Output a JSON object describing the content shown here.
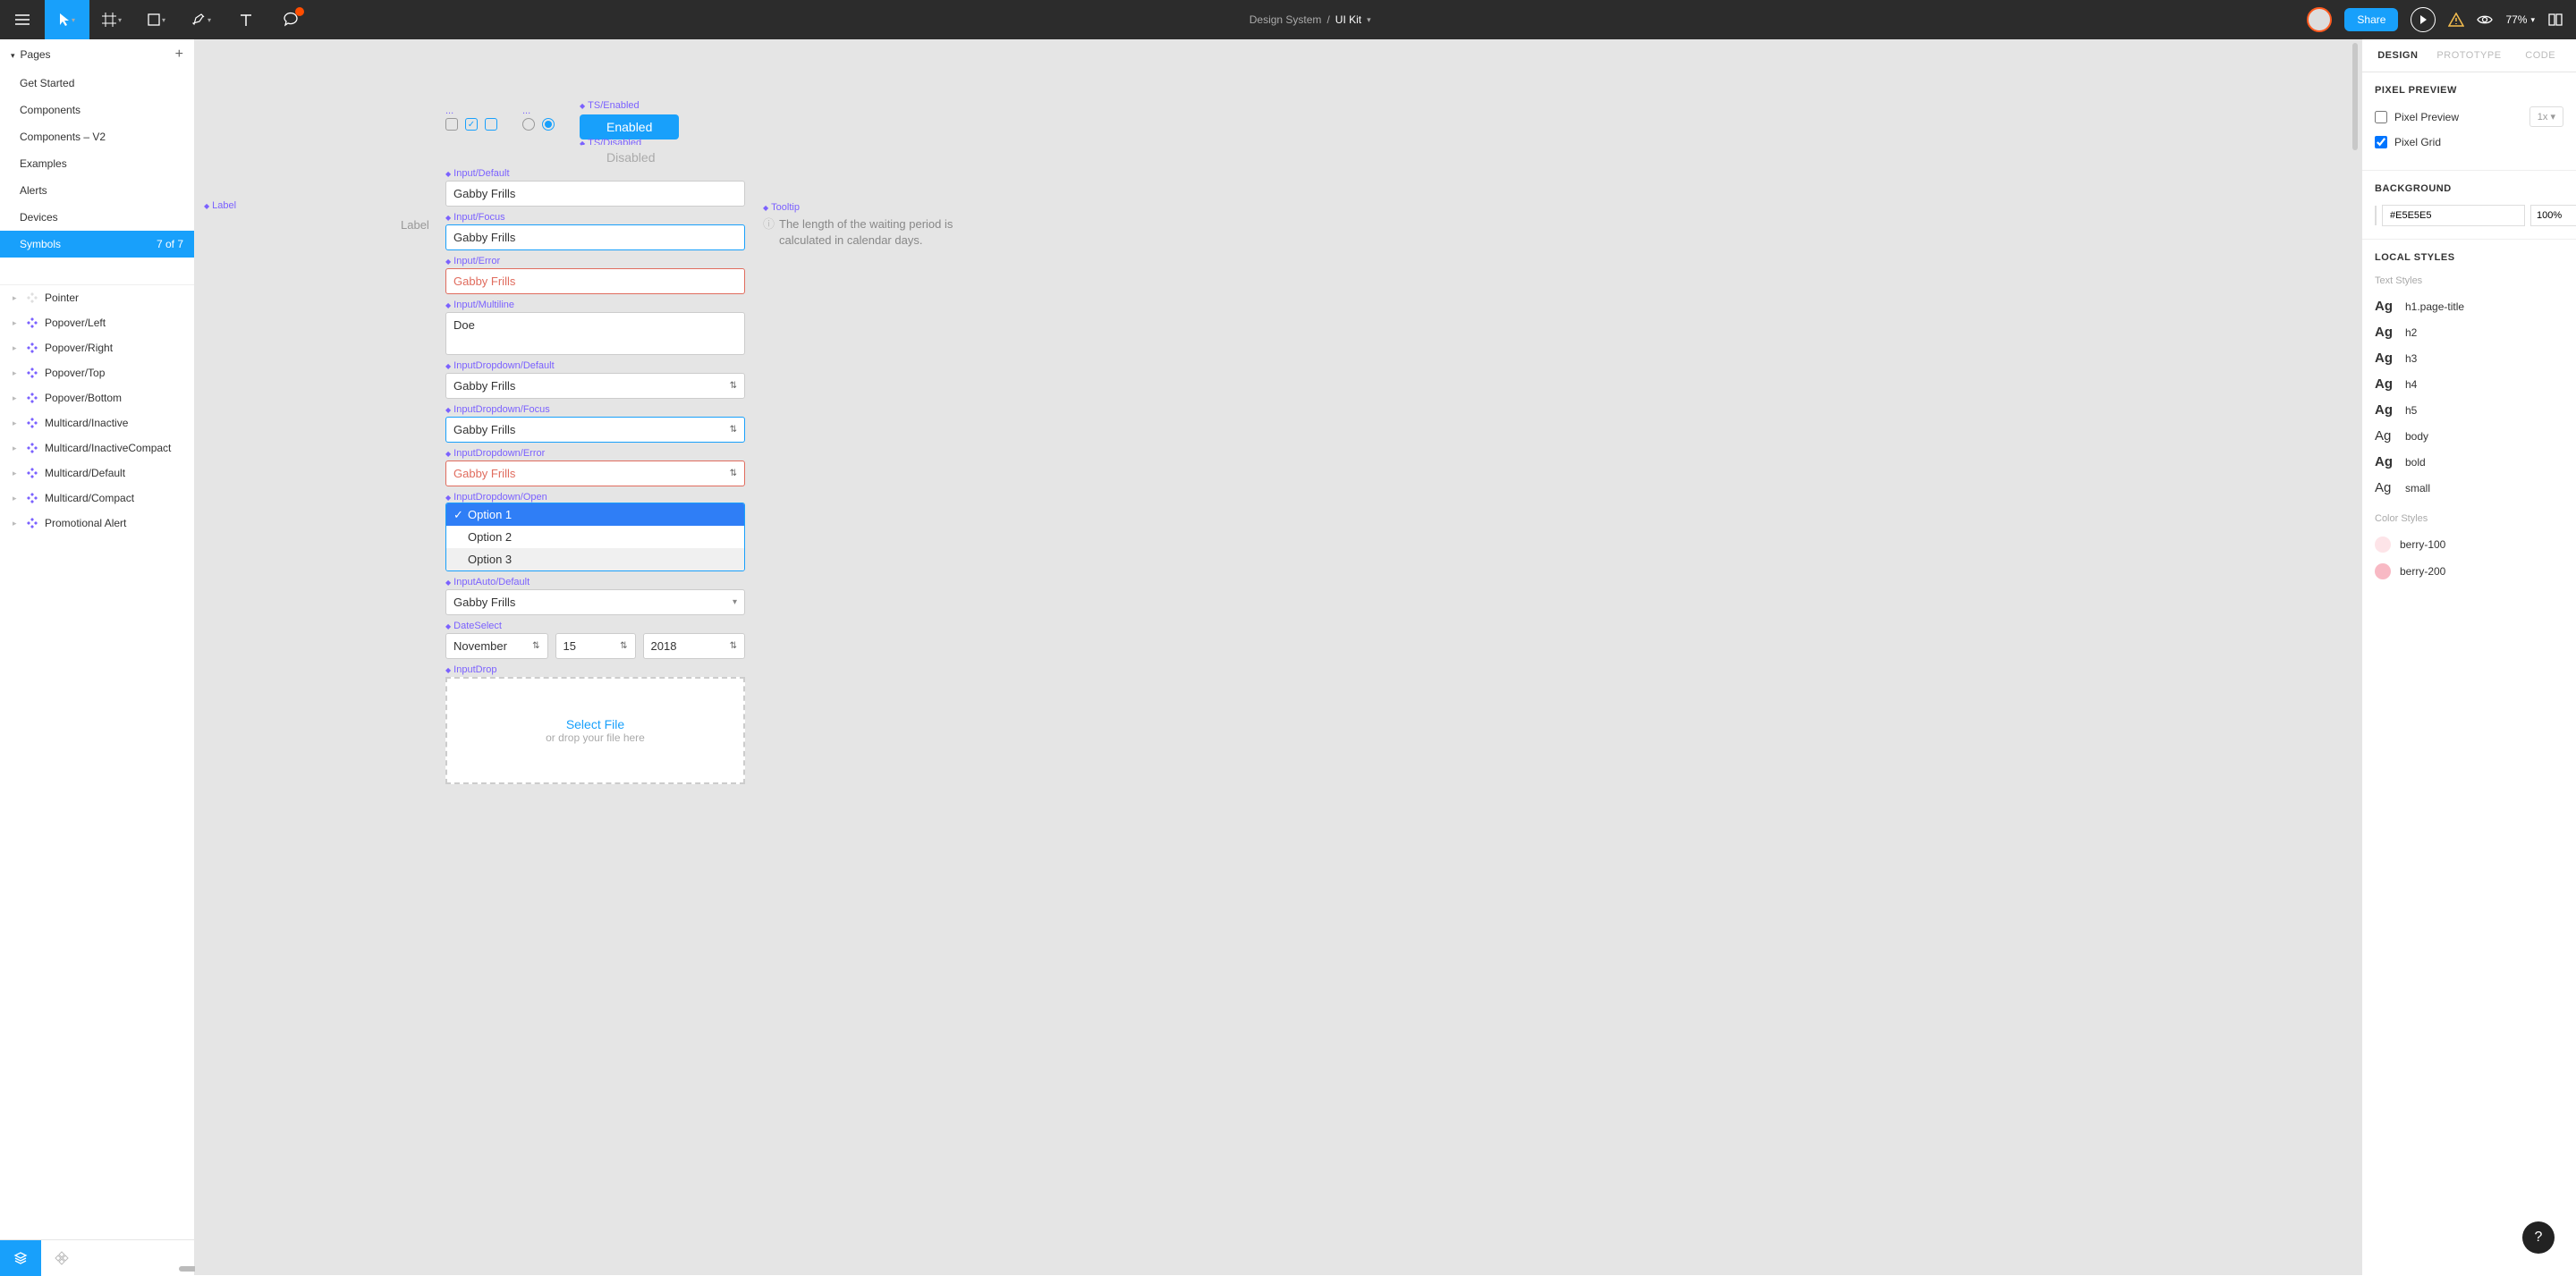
{
  "toolbar": {
    "breadcrumb_parent": "Design System",
    "breadcrumb_current": "UI Kit",
    "share_label": "Share",
    "zoom": "77%"
  },
  "left": {
    "pages_title": "Pages",
    "pages": [
      {
        "label": "Get Started"
      },
      {
        "label": "Components"
      },
      {
        "label": "Components – V2"
      },
      {
        "label": "Examples"
      },
      {
        "label": "Alerts"
      },
      {
        "label": "Devices"
      },
      {
        "label": "Symbols",
        "selected": true,
        "count": "7 of 7"
      }
    ],
    "layers": [
      {
        "label": "Pointer",
        "dim": true
      },
      {
        "label": "Popover/Left"
      },
      {
        "label": "Popover/Right"
      },
      {
        "label": "Popover/Top"
      },
      {
        "label": "Popover/Bottom"
      },
      {
        "label": "Multicard/Inactive"
      },
      {
        "label": "Multicard/InactiveCompact"
      },
      {
        "label": "Multicard/Default"
      },
      {
        "label": "Multicard/Compact"
      },
      {
        "label": "Promotional Alert"
      }
    ]
  },
  "canvas": {
    "label_frame": "Label",
    "label_text": "Label",
    "ts_enabled": "TS/Enabled",
    "ts_disabled": "TS/Disabled",
    "btn_enabled": "Enabled",
    "btn_disabled": "Disabled",
    "input_default": "Input/Default",
    "input_focus": "Input/Focus",
    "input_error": "Input/Error",
    "input_multiline": "Input/Multiline",
    "dd_default": "InputDropdown/Default",
    "dd_focus": "InputDropdown/Focus",
    "dd_error": "InputDropdown/Error",
    "dd_open": "InputDropdown/Open",
    "auto_default": "InputAuto/Default",
    "date_select": "DateSelect",
    "input_drop": "InputDrop",
    "tooltip_frame": "Tooltip",
    "val_name": "Gabby Frills",
    "val_multi": "Doe",
    "opt1": "Option 1",
    "opt2": "Option 2",
    "opt3": "Option 3",
    "date_month": "November",
    "date_day": "15",
    "date_year": "2018",
    "drop_select": "Select File",
    "drop_sub": "or drop your file here",
    "tooltip_text": "The length of the waiting period is calculated in calendar days."
  },
  "right": {
    "tab_design": "DESIGN",
    "tab_prototype": "PROTOTYPE",
    "tab_code": "CODE",
    "pixel_preview_title": "PIXEL PREVIEW",
    "pixel_preview_label": "Pixel Preview",
    "pixel_preview_scale": "1x",
    "pixel_grid_label": "Pixel Grid",
    "background_title": "BACKGROUND",
    "background_hex": "#E5E5E5",
    "background_pct": "100%",
    "local_styles_title": "LOCAL STYLES",
    "text_styles_sub": "Text Styles",
    "color_styles_sub": "Color Styles",
    "text_styles": [
      {
        "label": "h1.page-title",
        "bold": true
      },
      {
        "label": "h2",
        "bold": true
      },
      {
        "label": "h3",
        "bold": true
      },
      {
        "label": "h4",
        "bold": true
      },
      {
        "label": "h5",
        "bold": true
      },
      {
        "label": "body",
        "bold": false
      },
      {
        "label": "bold",
        "bold": true
      },
      {
        "label": "small",
        "bold": false
      }
    ],
    "color_styles": [
      {
        "label": "berry-100",
        "hex": "#fde4e8"
      },
      {
        "label": "berry-200",
        "hex": "#f8b9c4"
      }
    ]
  },
  "help": "?"
}
